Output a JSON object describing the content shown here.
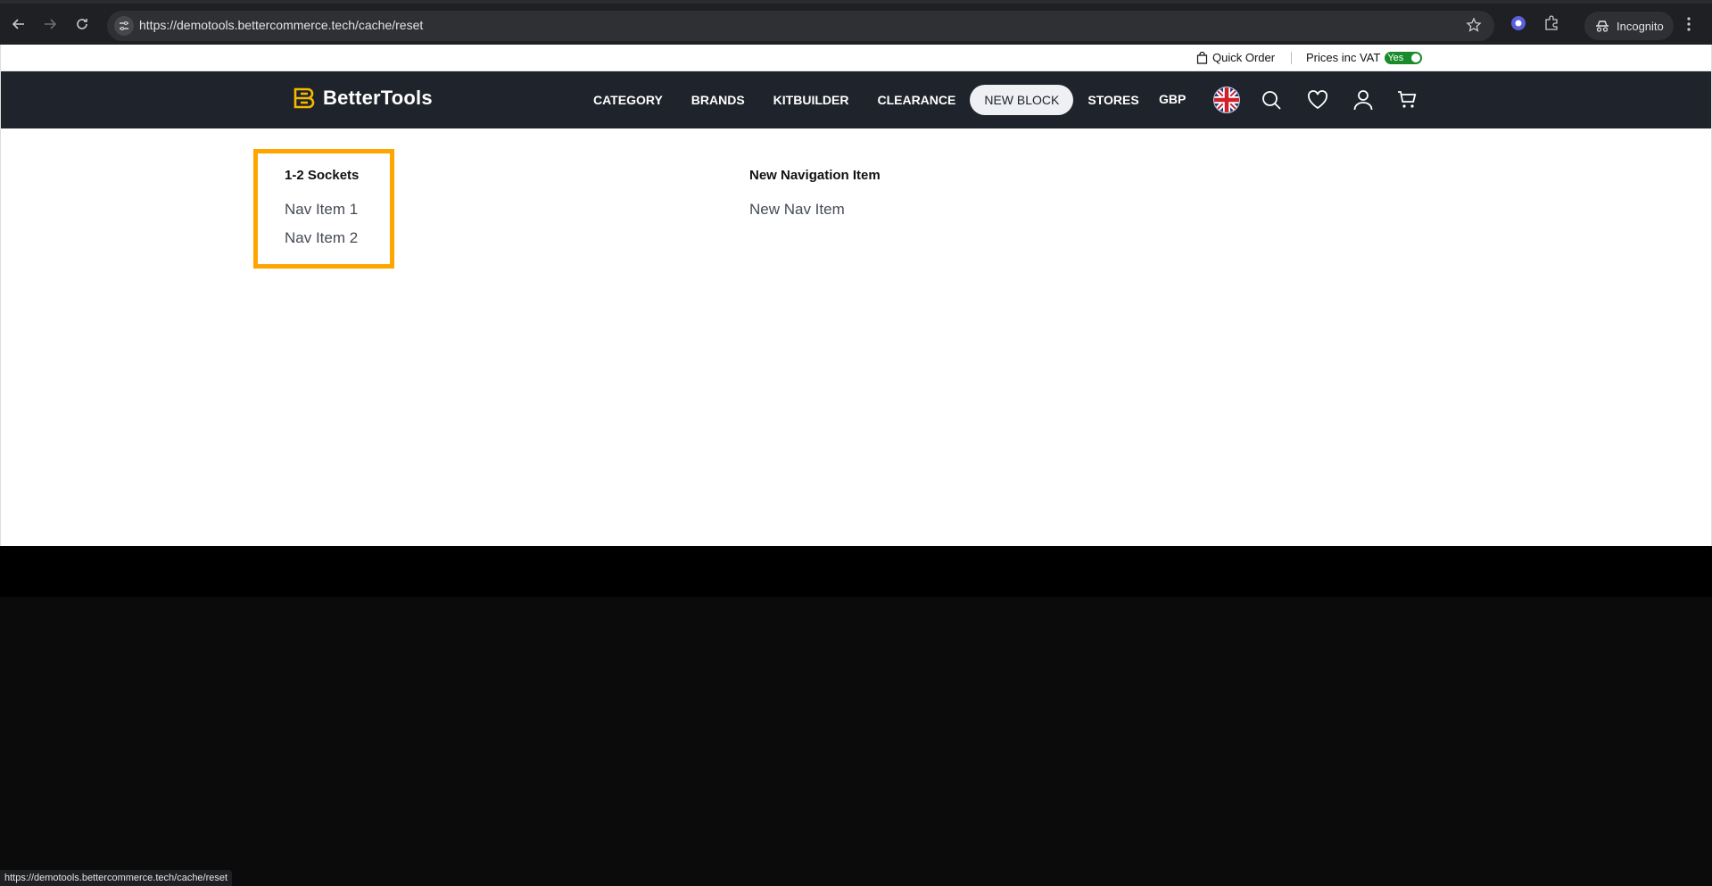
{
  "browser": {
    "url": "https://demotools.bettercommerce.tech/cache/reset",
    "incognito_label": "Incognito",
    "status_url": "https://demotools.bettercommerce.tech/cache/reset"
  },
  "topbar": {
    "quick_order": "Quick Order",
    "vat_label": "Prices inc VAT",
    "vat_toggle": "Yes",
    "vat_toggle_color": "#1a8b2b"
  },
  "header": {
    "brand": "BetterTools",
    "brand_color": "#f5b800",
    "menu": [
      {
        "label": "CATEGORY"
      },
      {
        "label": "BRANDS"
      },
      {
        "label": "KITBUILDER"
      },
      {
        "label": "CLEARANCE"
      },
      {
        "label": "NEW BLOCK",
        "active": true
      },
      {
        "label": "STORES"
      }
    ],
    "currency": "GBP",
    "icons": [
      "uk-flag-icon",
      "search-icon",
      "heart-icon",
      "user-icon",
      "cart-icon"
    ]
  },
  "dropdown": {
    "highlight_color": "#ffa500",
    "columns": [
      {
        "title": "1-2 Sockets",
        "links": [
          "Nav Item 1",
          "Nav Item 2"
        ]
      },
      {
        "title": "New Navigation Item",
        "links": [
          "New Nav Item"
        ]
      }
    ]
  }
}
